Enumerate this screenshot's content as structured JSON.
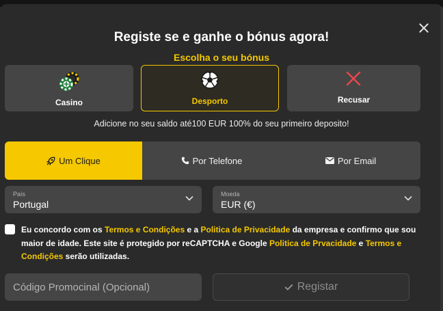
{
  "modal": {
    "title": "Registe se e ganhe o bónus agora!",
    "subtitle": "Escolha o seu bónus",
    "close_icon": "close-icon"
  },
  "bonus_options": {
    "casino": {
      "label": "Casino",
      "icon": "casino-chips-icon",
      "selected": false
    },
    "sport": {
      "label": "Desporto",
      "icon": "soccer-ball-icon",
      "selected": true
    },
    "refuse": {
      "label": "Recusar",
      "icon": "red-x-icon",
      "selected": false
    }
  },
  "promo_text": "Adicione no seu saldo até100 EUR 100% do seu primeiro deposito!",
  "register_tabs": {
    "one_click": {
      "label": "Um Clique",
      "icon": "rocket-icon",
      "active": true
    },
    "phone": {
      "label": "Por Telefone",
      "icon": "phone-icon",
      "active": false
    },
    "email": {
      "label": "Por Email",
      "icon": "envelope-icon",
      "active": false
    }
  },
  "country": {
    "label": "País",
    "value": "Portugal"
  },
  "currency": {
    "label": "Moeda",
    "value": "EUR (€)"
  },
  "terms": {
    "checked": false,
    "part1": "Eu concordo com os ",
    "link_terms": "Termos e Condições",
    "part2": " e a ",
    "link_privacy": "Politica de Privacidade",
    "part3": " da empresa e confirmo que sou maior de idade. Este site é protegido por reCAPTCHA e Google ",
    "link_google_privacy": "Politica de Prvacidade",
    "part4": " e ",
    "link_google_terms": "Termos e Condições",
    "part5": " serão utilizadas."
  },
  "promo_code": {
    "placeholder": "Código Promocinal (Opcional)",
    "value": ""
  },
  "register_button": {
    "label": "Registar",
    "icon": "check-icon"
  },
  "colors": {
    "accent": "#f5c800",
    "background": "#2a2a2a",
    "card": "#454545",
    "refuse_red": "#e8474c"
  }
}
